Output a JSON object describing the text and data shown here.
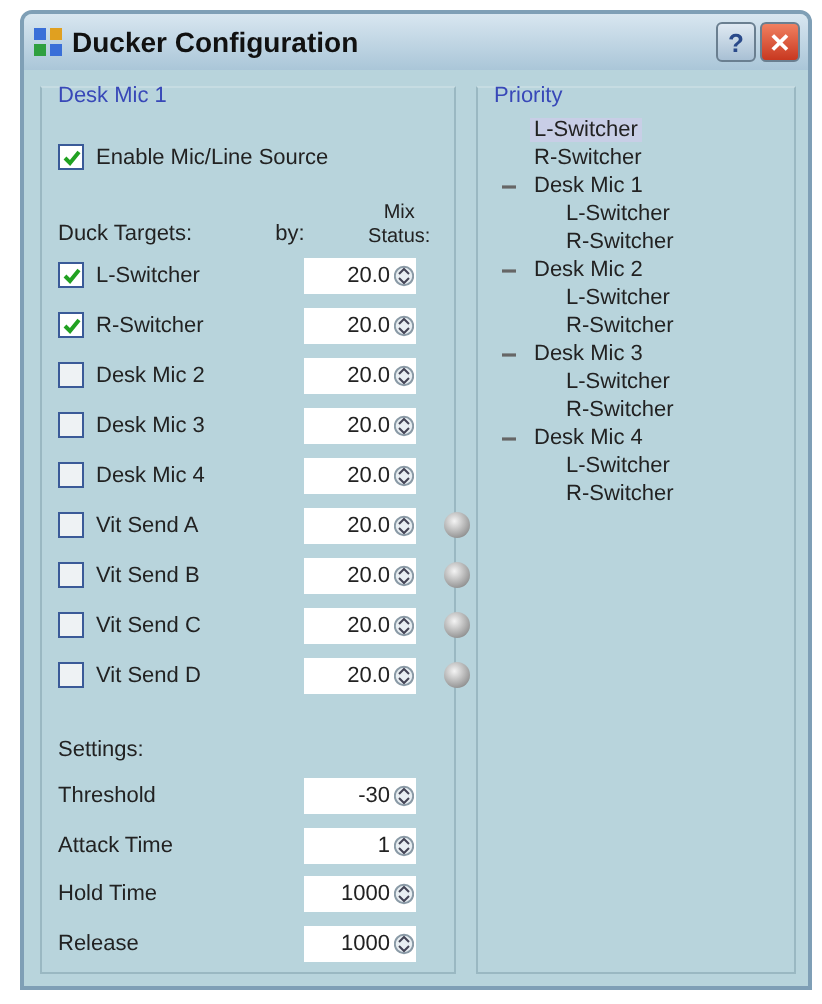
{
  "window": {
    "title": "Ducker Configuration",
    "buttons": [
      {
        "kind": "help",
        "label": "?"
      },
      {
        "kind": "close",
        "label": "✕"
      }
    ]
  },
  "source": {
    "title": "Desk Mic 1",
    "enable": {
      "label": "Enable Mic/Line Source",
      "checked": true
    }
  },
  "targets": {
    "heading": "Duck Targets:",
    "by_heading": "by:",
    "status_heading": "Mix Status:",
    "rows": [
      {
        "label": "L-Switcher",
        "checked": true,
        "value": "20.0"
      },
      {
        "label": "R-Switcher",
        "checked": true,
        "value": "20.0"
      },
      {
        "label": "Desk Mic 2",
        "checked": false,
        "value": "20.0"
      },
      {
        "label": "Desk Mic 3",
        "checked": false,
        "value": "20.0"
      },
      {
        "label": "Desk Mic 4",
        "checked": false,
        "value": "20.0"
      },
      {
        "label": "Vit Send A",
        "checked": false,
        "value": "20.0",
        "mix_status": {
          "lit": false
        }
      },
      {
        "label": "Vit Send B",
        "checked": false,
        "value": "20.0",
        "mix_status": {
          "lit": false
        }
      },
      {
        "label": "Vit Send C",
        "checked": false,
        "value": "20.0",
        "mix_status": {
          "lit": false
        }
      },
      {
        "label": "Vit Send D",
        "checked": false,
        "value": "20.0",
        "mix_status": {
          "lit": false
        }
      }
    ]
  },
  "settings": {
    "heading": "Settings:",
    "rows": [
      {
        "label": "Threshold",
        "value": "-30"
      },
      {
        "label": "Attack Time",
        "value": "1"
      },
      {
        "label": "Hold Time",
        "value": "1000"
      },
      {
        "label": "Release",
        "value": "1000"
      }
    ]
  },
  "priority": {
    "title": "Priority",
    "items": [
      {
        "label": "L-Switcher",
        "selected": true
      },
      {
        "label": "R-Switcher",
        "selected": false
      },
      {
        "label": "Desk Mic 1",
        "selected": false,
        "expanded": true,
        "children": [
          {
            "label": "L-Switcher",
            "selected": false
          },
          {
            "label": "R-Switcher",
            "selected": false
          }
        ]
      },
      {
        "label": "Desk Mic 2",
        "selected": false,
        "expanded": true,
        "children": [
          {
            "label": "L-Switcher",
            "selected": false
          },
          {
            "label": "R-Switcher",
            "selected": false
          }
        ]
      },
      {
        "label": "Desk Mic 3",
        "selected": false,
        "expanded": true,
        "children": [
          {
            "label": "L-Switcher",
            "selected": false
          },
          {
            "label": "R-Switcher",
            "selected": false
          }
        ]
      },
      {
        "label": "Desk Mic 4",
        "selected": false,
        "expanded": true,
        "children": [
          {
            "label": "L-Switcher",
            "selected": false
          },
          {
            "label": "R-Switcher",
            "selected": false
          }
        ]
      }
    ]
  }
}
